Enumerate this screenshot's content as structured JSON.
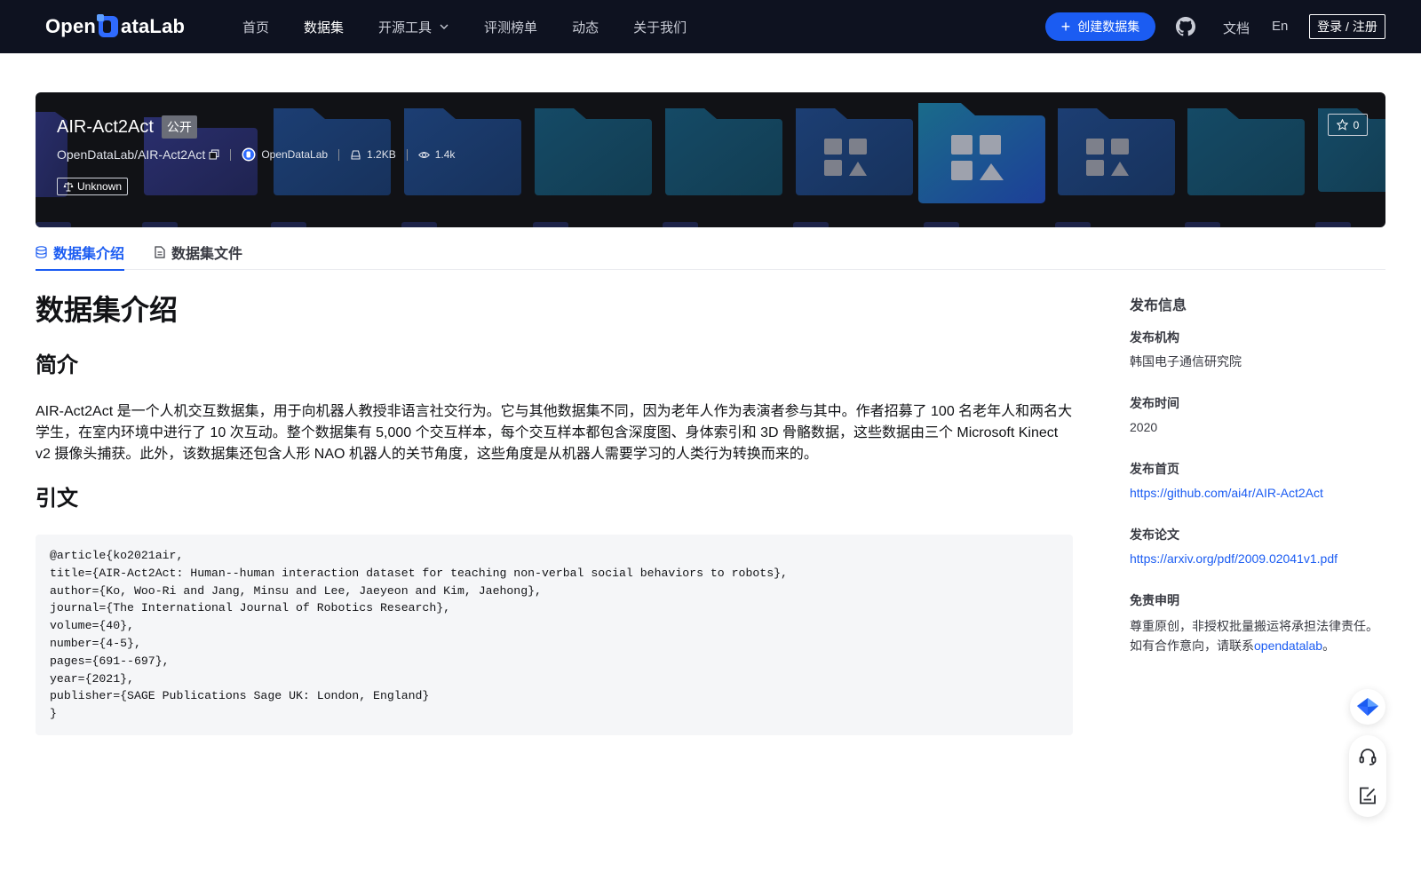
{
  "nav": {
    "logo_text_left": "Open",
    "logo_text_right": "ataLab",
    "links": [
      {
        "label": "首页"
      },
      {
        "label": "数据集"
      },
      {
        "label": "开源工具"
      },
      {
        "label": "评测榜单"
      },
      {
        "label": "动态"
      },
      {
        "label": "关于我们"
      }
    ],
    "create_label": "创建数据集",
    "docs_label": "文档",
    "lang_label": "En",
    "login_label": "登录 / 注册"
  },
  "banner": {
    "title": "AIR-Act2Act",
    "visibility": "公开",
    "repo_path": "OpenDataLab/AIR-Act2Act",
    "org": "OpenDataLab",
    "size": "1.2KB",
    "views": "1.4k",
    "license": "Unknown",
    "stars": "0"
  },
  "tabs": [
    {
      "label": "数据集介绍"
    },
    {
      "label": "数据集文件"
    }
  ],
  "main": {
    "heading": "数据集介绍",
    "intro_heading": "简介",
    "intro_text": "AIR-Act2Act 是一个人机交互数据集，用于向机器人教授非语言社交行为。它与其他数据集不同，因为老年人作为表演者参与其中。作者招募了 100 名老年人和两名大学生，在室内环境中进行了 10 次互动。整个数据集有 5,000 个交互样本，每个交互样本都包含深度图、身体索引和 3D 骨骼数据，这些数据由三个 Microsoft Kinect v2 摄像头捕获。此外，该数据集还包含人形 NAO 机器人的关节角度，这些角度是从机器人需要学习的人类行为转换而来的。",
    "citation_heading": "引文",
    "citation": "@article{ko2021air,\ntitle={AIR-Act2Act: Human--human interaction dataset for teaching non-verbal social behaviors to robots},\nauthor={Ko, Woo-Ri and Jang, Minsu and Lee, Jaeyeon and Kim, Jaehong},\njournal={The International Journal of Robotics Research},\nvolume={40},\nnumber={4-5},\npages={691--697},\nyear={2021},\npublisher={SAGE Publications Sage UK: London, England}\n}"
  },
  "sidebar": {
    "title": "发布信息",
    "org_label": "发布机构",
    "org_value": "韩国电子通信研究院",
    "time_label": "发布时间",
    "time_value": "2020",
    "home_label": "发布首页",
    "home_url": "https://github.com/ai4r/AIR-Act2Act",
    "paper_label": "发布论文",
    "paper_url": "https://arxiv.org/pdf/2009.02041v1.pdf",
    "disclaimer_label": "免责申明",
    "disclaimer_line1": "尊重原创，非授权批量搬运将承担法律责任。",
    "disclaimer_line2_prefix": "如有合作意向，请联系",
    "disclaimer_link": "opendatalab",
    "disclaimer_line2_suffix": "。"
  },
  "colors": {
    "nav_bg": "#0e1220",
    "accent": "#1b5cf2",
    "banner_bg": "#111216"
  },
  "icons": [
    "plus-icon",
    "github-icon",
    "chevron-down-icon",
    "copy-icon",
    "org-logo-icon",
    "drive-icon",
    "eye-icon",
    "scale-icon",
    "star-icon",
    "database-icon",
    "file-icon",
    "assistant-icon",
    "headset-icon",
    "feedback-icon"
  ]
}
